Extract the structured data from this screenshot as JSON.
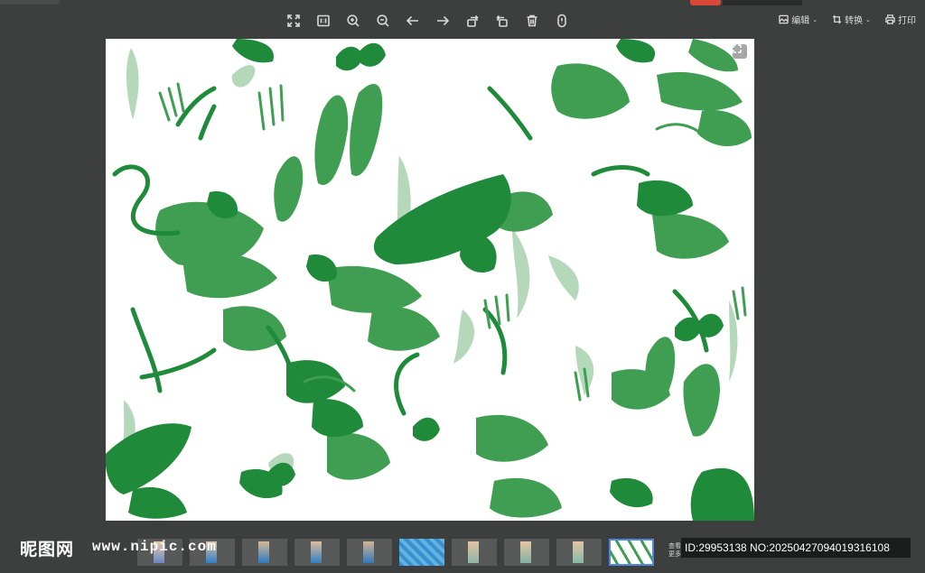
{
  "toolbar": {
    "buttons": [
      {
        "name": "fullscreen-button",
        "icon": "expand-icon"
      },
      {
        "name": "actual-size-button",
        "icon": "one-to-one-icon"
      },
      {
        "name": "zoom-in-button",
        "icon": "zoom-in-icon"
      },
      {
        "name": "zoom-out-button",
        "icon": "zoom-out-icon"
      },
      {
        "name": "previous-button",
        "icon": "arrow-left-icon"
      },
      {
        "name": "next-button",
        "icon": "arrow-right-icon"
      },
      {
        "name": "rotate-right-button",
        "icon": "rotate-right-icon"
      },
      {
        "name": "rotate-left-button",
        "icon": "rotate-left-icon"
      },
      {
        "name": "delete-button",
        "icon": "trash-icon"
      },
      {
        "name": "info-button",
        "icon": "info-icon"
      }
    ]
  },
  "top_right": {
    "edit_label": "编辑",
    "convert_label": "转换",
    "print_label": "打印"
  },
  "thumbnails": {
    "count": 10,
    "active_index": 9,
    "more_label_line1": "查看",
    "more_label_line2": "更多"
  },
  "watermark": {
    "logo": "昵图网",
    "url": "www.nipic.com",
    "id_text": "ID:29953138 NO:20250427094019316108"
  },
  "colors": {
    "background": "#3d3f3e",
    "leaf_dark": "#1f8a3a",
    "leaf_mid": "#3f9e52",
    "leaf_light": "#9cc8a3",
    "active_thumb": "#4e86e8"
  }
}
